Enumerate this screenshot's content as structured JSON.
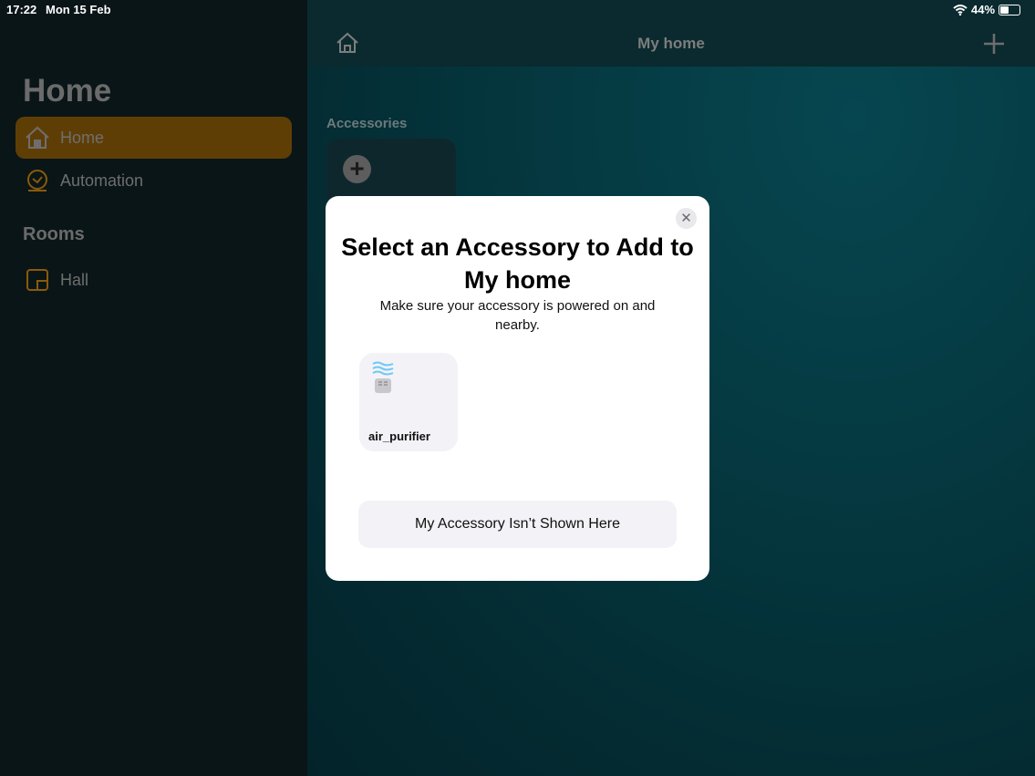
{
  "status_bar": {
    "time": "17:22",
    "date": "Mon 15 Feb",
    "battery": "44%",
    "battery_level": 0.44
  },
  "sidebar": {
    "title": "Home",
    "items": [
      {
        "label": "Home",
        "icon": "house-icon",
        "selected": true
      },
      {
        "label": "Automation",
        "icon": "clock-icon",
        "selected": false
      }
    ],
    "rooms_header": "Rooms",
    "rooms": [
      {
        "label": "Hall",
        "icon": "room-icon"
      }
    ]
  },
  "navbar": {
    "title": "My home"
  },
  "main": {
    "section_label": "Accessories"
  },
  "modal": {
    "title": "Select an Accessory to Add to My home",
    "subtitle": "Make sure your accessory is powered on and nearby.",
    "accessories": [
      {
        "name": "air_purifier",
        "icon": "air-purifier-icon"
      }
    ],
    "not_shown_button": "My Accessory Isn’t Shown Here"
  },
  "colors": {
    "accent": "#f29f05",
    "selected_bg": "#5f3e06"
  }
}
